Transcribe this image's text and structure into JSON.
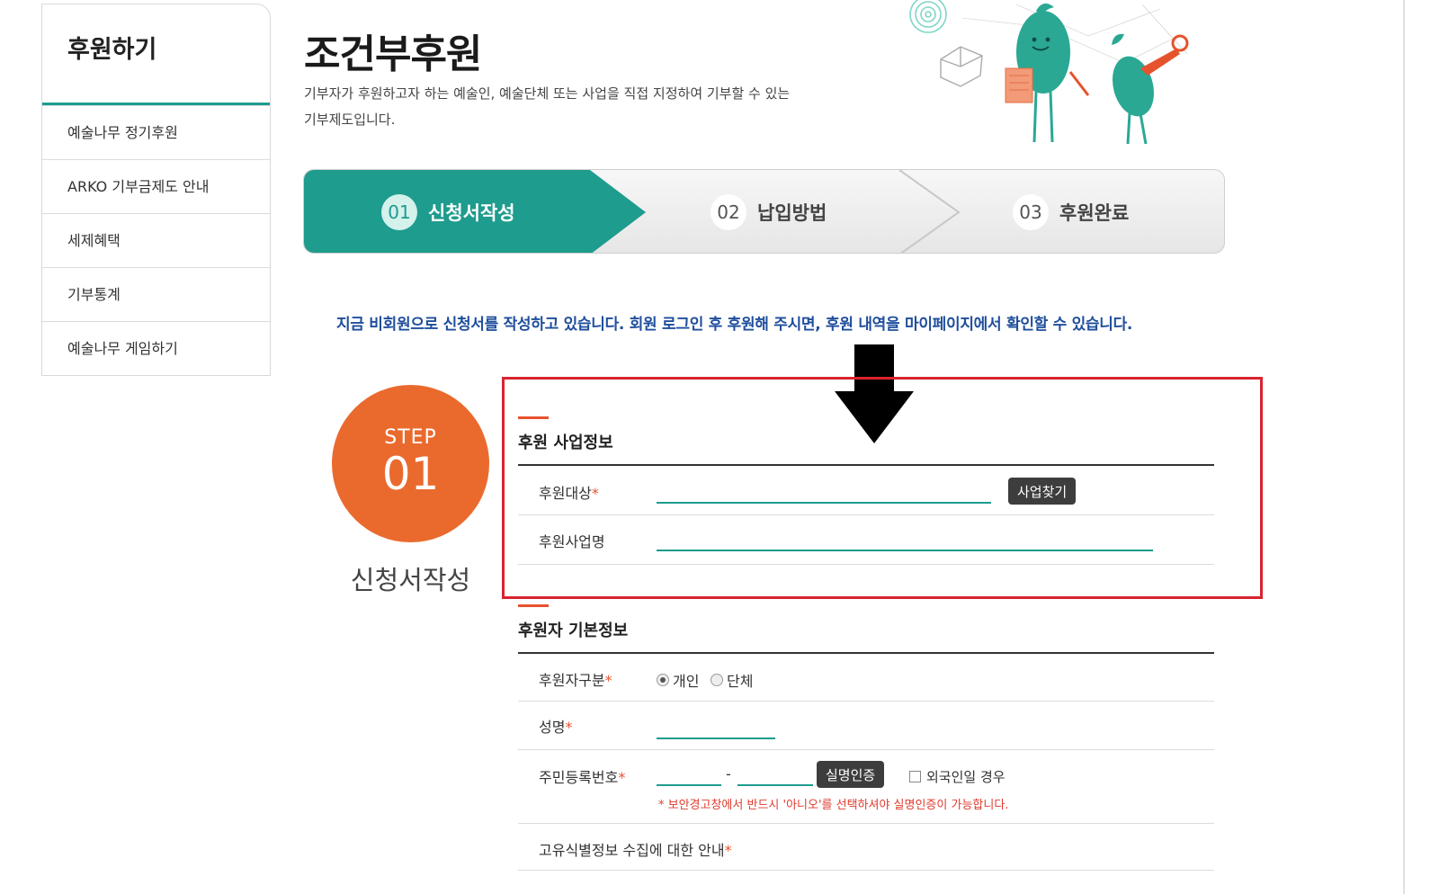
{
  "sidebar": {
    "title": "후원하기",
    "items": [
      {
        "label": "예술나무 정기후원"
      },
      {
        "label": "ARKO 기부금제도 안내"
      },
      {
        "label": "세제혜택"
      },
      {
        "label": "기부통계"
      },
      {
        "label": "예술나무 게임하기"
      }
    ]
  },
  "header": {
    "title": "조건부후원",
    "desc_line1": "기부자가 후원하고자 하는 예술인, 예술단체 또는 사업을 직접 지정하여 기부할 수 있는",
    "desc_line2": "기부제도입니다."
  },
  "steps": [
    {
      "num": "01",
      "label": "신청서작성",
      "active": true
    },
    {
      "num": "02",
      "label": "납입방법",
      "active": false
    },
    {
      "num": "03",
      "label": "후원완료",
      "active": false
    }
  ],
  "notice": "지금 비회원으로 신청서를 작성하고 있습니다. 회원 로그인 후 후원해 주시면, 후원 내역을 마이페이지에서 확인할 수 있습니다.",
  "badge": {
    "label": "STEP",
    "num": "01",
    "caption": "신청서작성"
  },
  "sponsor_info": {
    "title": "후원 사업정보",
    "target_label": "후원대상",
    "find_button": "사업찾기",
    "project_label": "후원사업명",
    "target_value": "",
    "project_value": ""
  },
  "donor_info": {
    "title": "후원자 기본정보",
    "type_label": "후원자구분",
    "type_options": [
      "개인",
      "단체"
    ],
    "type_selected": "개인",
    "name_label": "성명",
    "name_value": "",
    "rrn_label": "주민등록번호",
    "rrn_dash": "-",
    "verify_button": "실명인증",
    "foreigner_label": "외국인일 경우",
    "warning": "* 보안경고창에서 반드시 '아니오'를 선택하셔야 실명인증이 가능합니다.",
    "unique_id_label": "고유식별정보 수집에 대한 안내"
  },
  "colors": {
    "teal": "#1e9c8e",
    "orange": "#ea6a2e",
    "highlight_red": "#d8242f",
    "notice_blue": "#1f4e9c"
  }
}
